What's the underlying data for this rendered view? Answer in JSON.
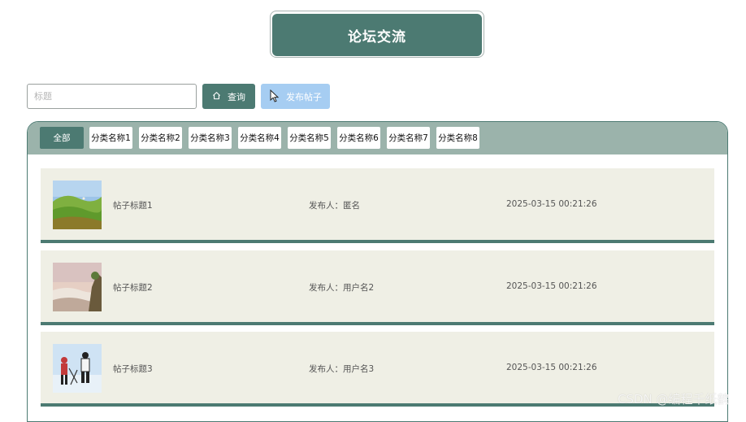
{
  "header": {
    "title": "论坛交流"
  },
  "search": {
    "placeholder": "标题",
    "query_label": "查询",
    "post_label": "发布帖子"
  },
  "categories": [
    {
      "label": "全部",
      "active": true
    },
    {
      "label": "分类名称1"
    },
    {
      "label": "分类名称2"
    },
    {
      "label": "分类名称3"
    },
    {
      "label": "分类名称4"
    },
    {
      "label": "分类名称5"
    },
    {
      "label": "分类名称6"
    },
    {
      "label": "分类名称7"
    },
    {
      "label": "分类名称8"
    }
  ],
  "posts": [
    {
      "title": "帖子标题1",
      "author": "发布人：匿名",
      "time": "2025-03-15 00:21:26"
    },
    {
      "title": "帖子标题2",
      "author": "发布人：用户名2",
      "time": "2025-03-15 00:21:26"
    },
    {
      "title": "帖子标题3",
      "author": "发布人：用户名3",
      "time": "2025-03-15 00:21:26"
    }
  ],
  "watermark": "CSDN @编程千纸鹤",
  "colors": {
    "accent": "#4c7a72",
    "category_bar": "#9bb3ab",
    "post_bg": "#efefe5",
    "post_button": "#a6cdf2"
  },
  "icons": {
    "query": "home-icon",
    "cursor": "mouse-pointer-icon"
  }
}
